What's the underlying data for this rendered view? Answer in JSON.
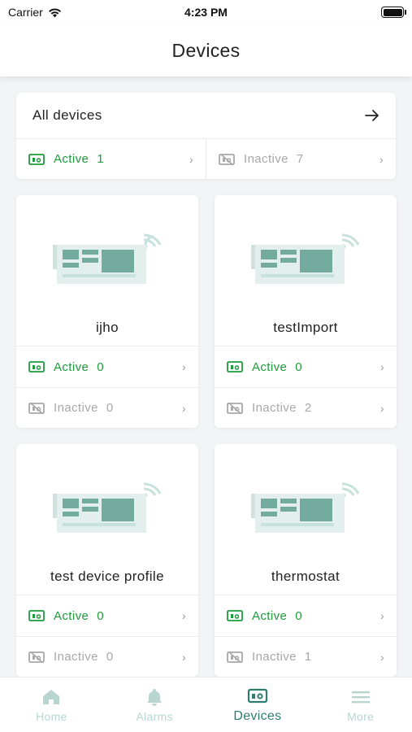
{
  "status_bar": {
    "carrier": "Carrier",
    "time": "4:23 PM",
    "icons": [
      "wifi-icon",
      "battery-icon"
    ]
  },
  "header": {
    "title": "Devices"
  },
  "all_devices": {
    "title": "All devices",
    "active_label": "Active",
    "active_count": "1",
    "inactive_label": "Inactive",
    "inactive_count": "7"
  },
  "profiles": [
    {
      "name": "ijho",
      "active_label": "Active",
      "active_count": "0",
      "inactive_label": "Inactive",
      "inactive_count": "0"
    },
    {
      "name": "testImport",
      "active_label": "Active",
      "active_count": "0",
      "inactive_label": "Inactive",
      "inactive_count": "2"
    },
    {
      "name": "test device profile",
      "active_label": "Active",
      "active_count": "0",
      "inactive_label": "Inactive",
      "inactive_count": "0"
    },
    {
      "name": "thermostat",
      "active_label": "Active",
      "active_count": "0",
      "inactive_label": "Inactive",
      "inactive_count": "1"
    }
  ],
  "bottom_nav": {
    "items": [
      {
        "label": "Home",
        "icon": "home-icon"
      },
      {
        "label": "Alarms",
        "icon": "bell-icon"
      },
      {
        "label": "Devices",
        "icon": "devices-icon",
        "selected": true
      },
      {
        "label": "More",
        "icon": "menu-icon"
      }
    ]
  },
  "colors": {
    "active": "#1d9c3a",
    "inactive": "#a8a8a8",
    "accent": "#2e7d6e",
    "nav_inactive": "#b8d6cf",
    "device_board": "#e2efec",
    "device_chip": "#74ab9f"
  }
}
